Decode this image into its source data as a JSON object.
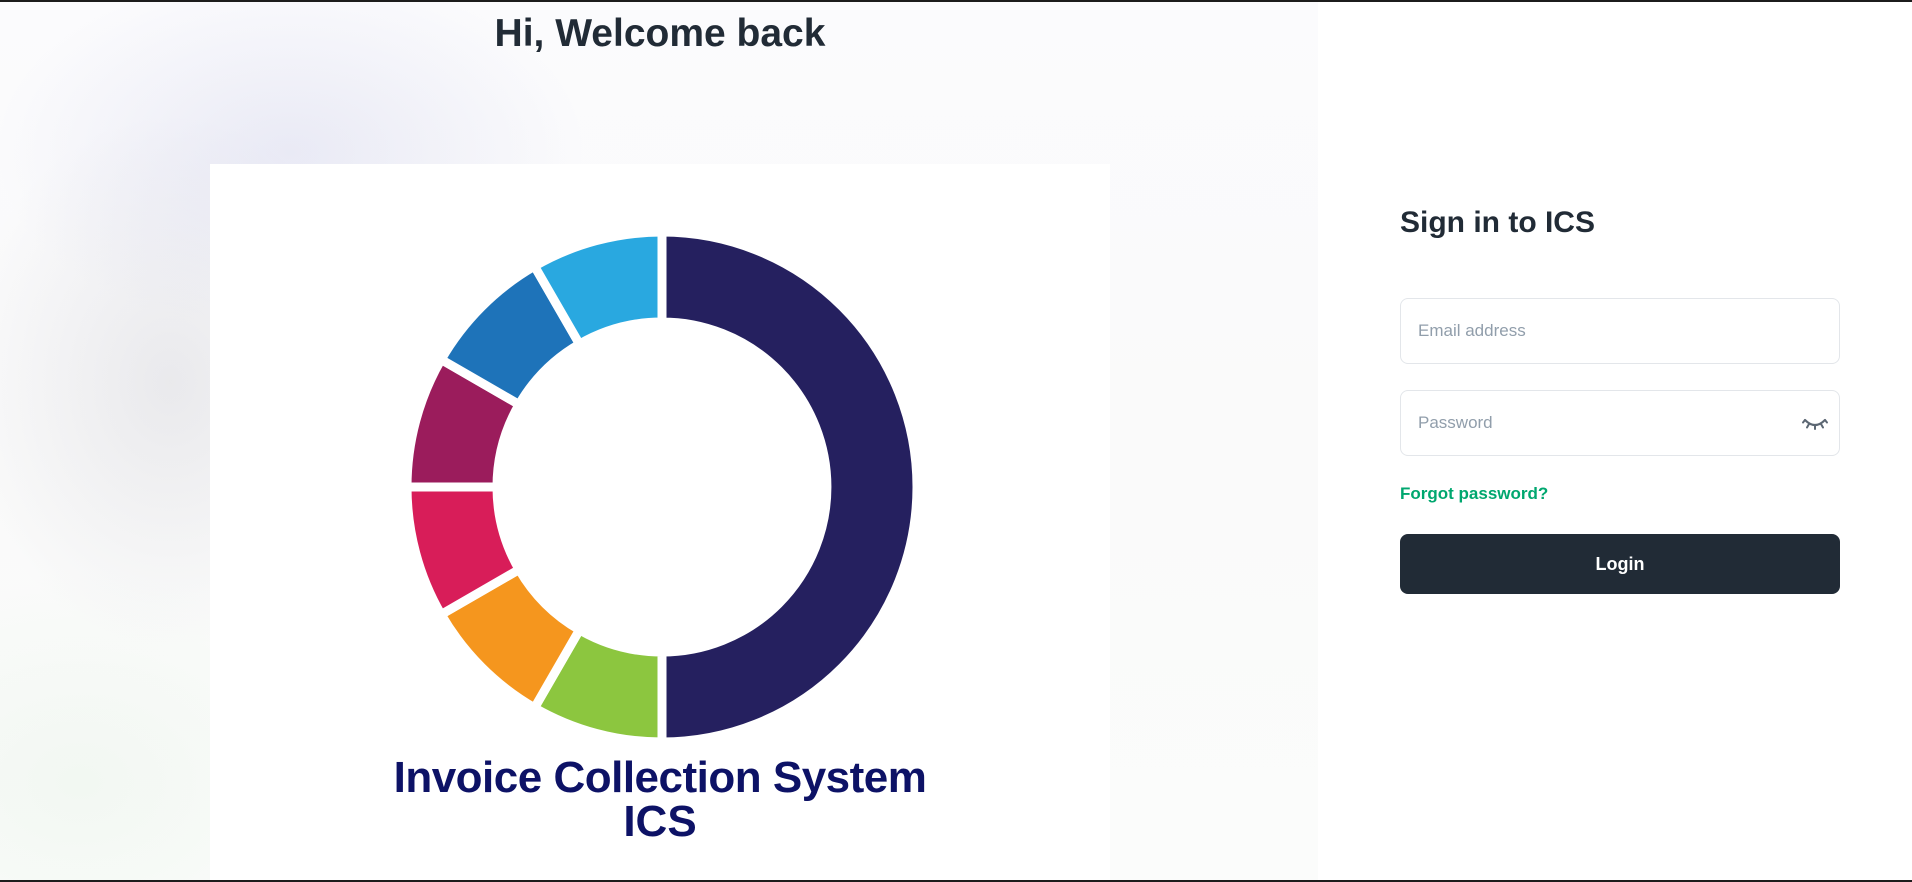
{
  "page": {
    "welcome_heading": "Hi, Welcome back"
  },
  "logo": {
    "title_line1": "Invoice Collection System",
    "title_line2": "ICS",
    "ring_colors": {
      "main": "#25205f",
      "light_blue": "#29a8e0",
      "blue": "#1e73b9",
      "purple": "#9b1c5c",
      "pink": "#d81d59",
      "orange": "#f5961e",
      "green": "#8cc63f"
    },
    "title_color": "#0d1266"
  },
  "signin": {
    "title": "Sign in to ICS",
    "email_placeholder": "Email address",
    "email_value": "",
    "password_placeholder": "Password",
    "password_value": "",
    "password_toggle_icon": "eye-closed-icon",
    "forgot_password_label": "Forgot password?",
    "login_label": "Login"
  },
  "colors": {
    "accent_link": "#00a76f",
    "button_bg": "#212b36",
    "heading_text": "#212b36",
    "placeholder_text": "#919eab"
  }
}
